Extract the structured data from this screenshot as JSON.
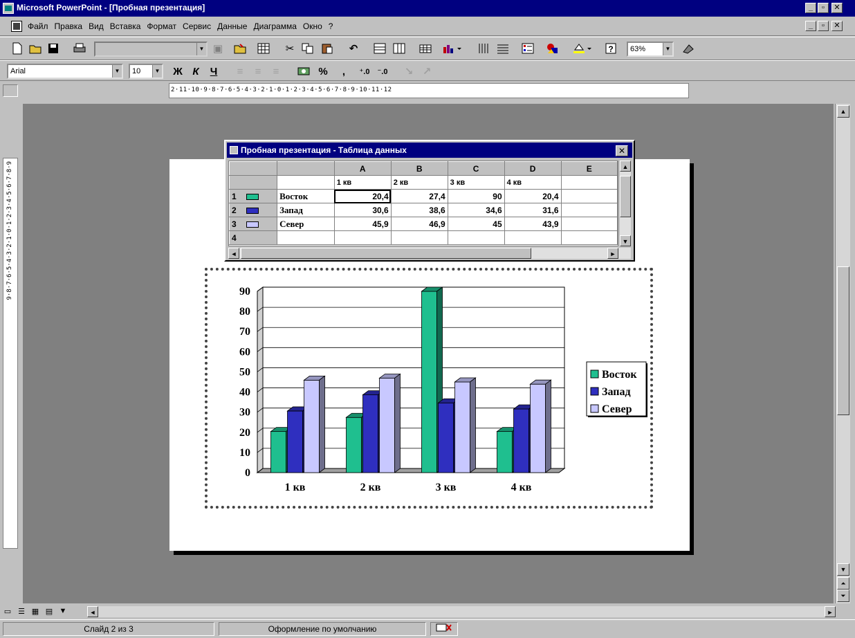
{
  "window": {
    "title": "Microsoft PowerPoint - [Пробная презентация]",
    "controls": [
      "_",
      "▫",
      "✕"
    ]
  },
  "menu": {
    "items": [
      "Файл",
      "Правка",
      "Вид",
      "Вставка",
      "Формат",
      "Сервис",
      "Данные",
      "Диаграмма",
      "Окно",
      "?"
    ]
  },
  "toolbar1": {
    "zoom": "63%"
  },
  "toolbar2": {
    "font": "Arial",
    "size": "10",
    "bold": "Ж",
    "italic": "К",
    "underline": "Ч",
    "percent": "%",
    "comma": ","
  },
  "ruler": {
    "horizontal": "2·11·10·9·8·7·6·5·4·3·2·1·0·1·2·3·4·5·6·7·8·9·10·11·12",
    "vertical": "9·8·7·6·5·4·3·2·1·0·1·2·3·4·5·6·7·8·9"
  },
  "datasheet": {
    "title": "Пробная презентация - Таблица данных",
    "col_headers": [
      "A",
      "B",
      "C",
      "D",
      "E"
    ],
    "categories": [
      "1 кв",
      "2 кв",
      "3 кв",
      "4 кв"
    ],
    "rows": [
      {
        "num": "1",
        "label": "Восток",
        "values": [
          "20,4",
          "27,4",
          "90",
          "20,4"
        ]
      },
      {
        "num": "2",
        "label": "Запад",
        "values": [
          "30,6",
          "38,6",
          "34,6",
          "31,6"
        ]
      },
      {
        "num": "3",
        "label": "Север",
        "values": [
          "45,9",
          "46,9",
          "45",
          "43,9"
        ]
      },
      {
        "num": "4",
        "label": "",
        "values": [
          "",
          "",
          "",
          ""
        ]
      }
    ]
  },
  "chart_data": {
    "type": "bar",
    "categories": [
      "1 кв",
      "2 кв",
      "3 кв",
      "4 кв"
    ],
    "series": [
      {
        "name": "Восток",
        "values": [
          20.4,
          27.4,
          90,
          20.4
        ],
        "color": "#1fbf8f"
      },
      {
        "name": "Запад",
        "values": [
          30.6,
          38.6,
          34.6,
          31.6
        ],
        "color": "#2f2fbf"
      },
      {
        "name": "Север",
        "values": [
          45.9,
          46.9,
          45,
          43.9
        ],
        "color": "#c8c8ff"
      }
    ],
    "ylim": [
      0,
      90
    ],
    "yticks": [
      "0",
      "10",
      "20",
      "30",
      "40",
      "50",
      "60",
      "70",
      "80",
      "90"
    ],
    "grid": true,
    "legend_position": "right",
    "style": "3d-column"
  },
  "status": {
    "slide": "Слайд 2 из 3",
    "design": "Оформление по умолчанию"
  }
}
